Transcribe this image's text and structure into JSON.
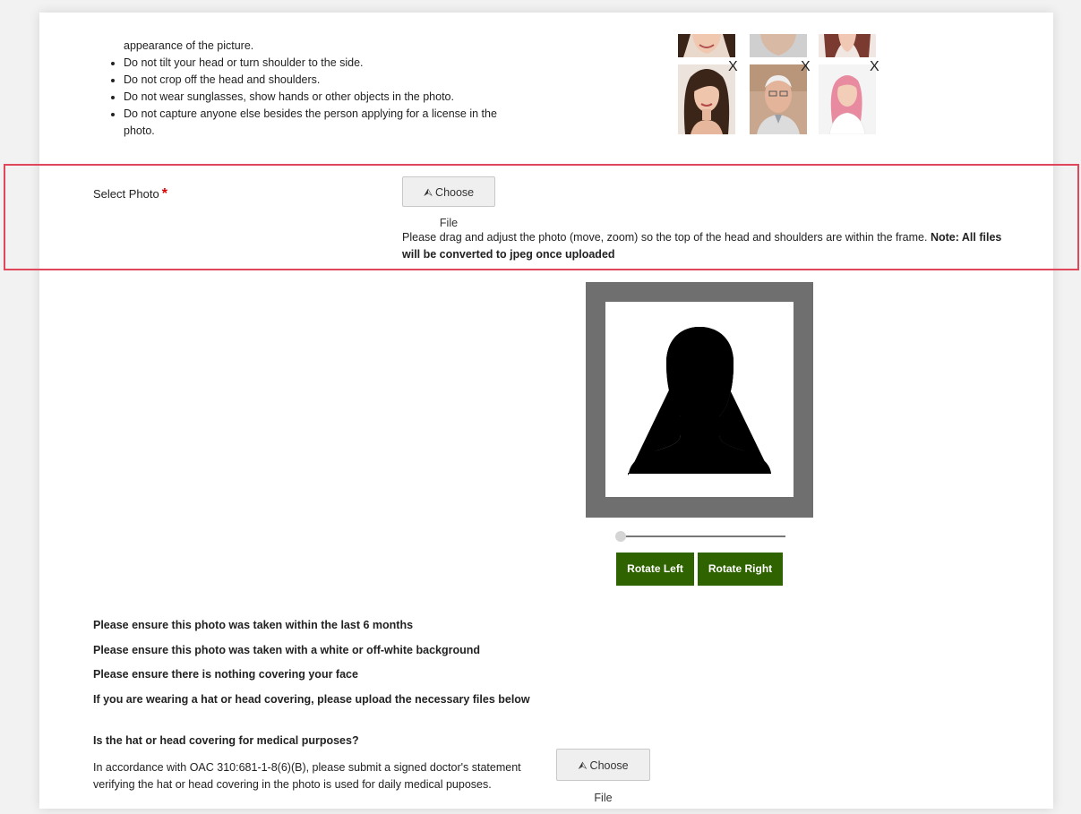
{
  "rules": {
    "continuation": "appearance of the picture.",
    "items": [
      "Do not tilt your head or turn shoulder to the side.",
      "Do not crop off the head and shoulders.",
      "Do not wear sunglasses, show hands or other objects in the photo.",
      "Do not capture anyone else besides the person applying for a license in the photo."
    ]
  },
  "examples": {
    "mark_glyph": "X",
    "count_bottom_row": 3
  },
  "select_photo": {
    "label": "Select Photo",
    "required_mark": "*",
    "button_label": "Choose File",
    "note_text": "Please drag and adjust the photo (move, zoom) so the top of the head and shoulders are within the frame. ",
    "note_bold": "Note: All files will be converted to jpeg once uploaded"
  },
  "editor": {
    "zoom_fraction": 0.0,
    "rotate_left_label": "Rotate Left",
    "rotate_right_label": "Rotate Right"
  },
  "requirements": [
    "Please ensure this photo was taken within the last 6 months",
    "Please ensure this photo was taken with a white or off-white background",
    "Please ensure there is nothing covering your face",
    "If you are wearing a hat or head covering, please upload the necessary files below"
  ],
  "medical": {
    "question": "Is the hat or head covering for medical purposes?",
    "text": "In accordance with OAC 310:681-1-8(6)(B), please submit a signed doctor's statement verifying the hat or head covering in the photo is used for daily medical puposes.",
    "button_label": "Choose File"
  },
  "colors": {
    "highlight_border": "#e0475a",
    "required": "#dd0000",
    "button_green": "#2e6300",
    "frame_gray": "#6f6f6f",
    "reject_mark": "#dd4444"
  },
  "icons": {
    "upload": "upload-icon",
    "silhouette": "person-silhouette-icon",
    "reject": "reject-x-icon"
  }
}
